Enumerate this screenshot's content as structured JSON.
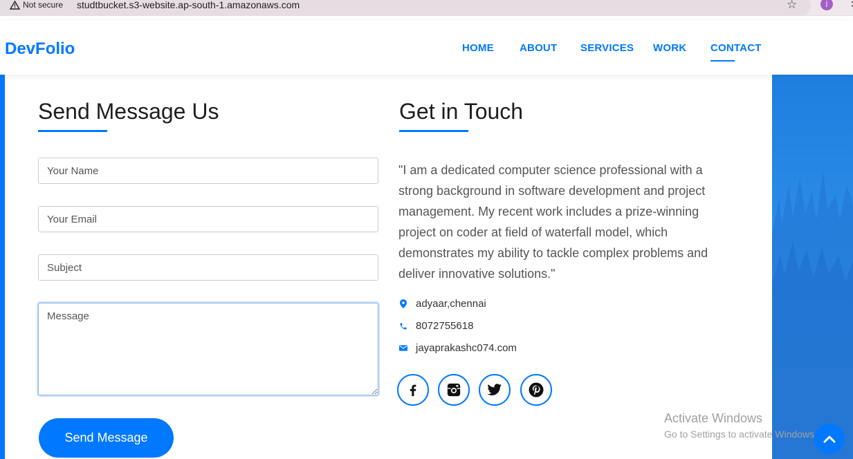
{
  "browser": {
    "security_label": "Not secure",
    "url": "studtbucket.s3-website.ap-south-1.amazonaws.com",
    "profile_initial": "j"
  },
  "header": {
    "logo": "DevFolio",
    "nav": [
      "HOME",
      "ABOUT",
      "SERVICES",
      "WORK",
      "CONTACT"
    ],
    "active_nav": "CONTACT"
  },
  "form": {
    "title": "Send Message Us",
    "name_placeholder": "Your Name",
    "email_placeholder": "Your Email",
    "subject_placeholder": "Subject",
    "message_placeholder": "Message",
    "submit_label": "Send Message"
  },
  "contact": {
    "title": "Get in Touch",
    "quote": "\"I am a dedicated computer science professional with a strong background in software development and project management. My recent work includes a prize-winning project on coder at field of waterfall model, which demonstrates my ability to tackle complex problems and deliver innovative solutions.\"",
    "address": "adyaar,chennai",
    "phone": "8072755618",
    "email": "jayaprakashc074.com",
    "social": [
      "facebook-icon",
      "instagram-icon",
      "twitter-icon",
      "pinterest-icon"
    ]
  },
  "watermark": {
    "line1": "Activate Windows",
    "line2": "Go to Settings to activate Windows."
  },
  "colors": {
    "accent": "#0078ff",
    "heading": "#1e1e1e",
    "body_text": "#555555"
  }
}
